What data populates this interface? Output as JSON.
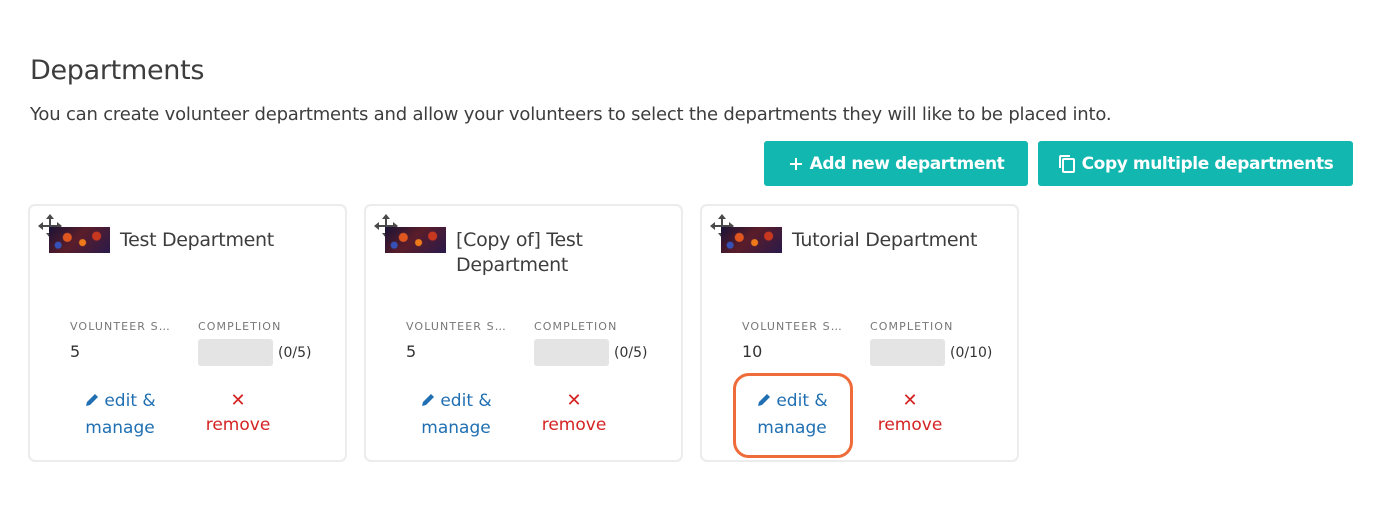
{
  "header": {
    "title": "Departments",
    "description": "You can create volunteer departments and allow your volunteers to select the departments they will like to be placed into."
  },
  "actions": {
    "add_label": "Add new department",
    "copy_label": "Copy multiple departments"
  },
  "columns": {
    "slots": "VOLUNTEER SLOTS",
    "completion": "COMPLETION"
  },
  "departments": [
    {
      "name": "Test Department",
      "slots": "5",
      "completion": "(0/5)",
      "filled_fraction": 0,
      "edit_label": "edit & manage",
      "remove_label": "remove"
    },
    {
      "name": "[Copy of] Test Department",
      "slots": "5",
      "completion": "(0/5)",
      "filled_fraction": 0,
      "edit_label": "edit & manage",
      "remove_label": "remove"
    },
    {
      "name": "Tutorial Department",
      "slots": "10",
      "completion": "(0/10)",
      "filled_fraction": 0,
      "edit_label": "edit & manage",
      "remove_label": "remove"
    }
  ],
  "colors": {
    "accent": "#12b8b0",
    "link": "#1f6fb2",
    "danger": "#d42222",
    "highlight": "#ef6c3a"
  },
  "icons": {
    "add": "plus-icon",
    "copy": "copy-icon",
    "drag": "move-icon",
    "edit": "pencil-icon",
    "remove": "close-icon"
  }
}
